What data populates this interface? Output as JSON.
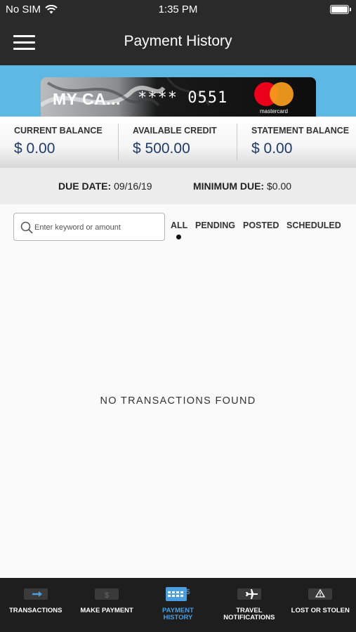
{
  "status": {
    "carrier": "No SIM",
    "time": "1:35 PM"
  },
  "nav": {
    "title": "Payment History"
  },
  "card": {
    "name": "MY CA...",
    "number": "**** 0551",
    "network": "mastercard"
  },
  "balances": [
    {
      "label": "CURRENT BALANCE",
      "value": "$ 0.00"
    },
    {
      "label": "AVAILABLE CREDIT",
      "value": "$ 500.00"
    },
    {
      "label": "STATEMENT BALANCE",
      "value": "$ 0.00"
    }
  ],
  "due": {
    "due_date_label": "DUE DATE:",
    "due_date_value": "09/16/19",
    "minimum_label": "MINIMUM DUE:",
    "minimum_value": "$0.00"
  },
  "search": {
    "placeholder": "Enter keyword or amount",
    "value": ""
  },
  "filters": {
    "selected": "ALL",
    "tabs": [
      "ALL",
      "PENDING",
      "POSTED",
      "SCHEDULED"
    ]
  },
  "empty_state": "NO TRANSACTIONS FOUND",
  "tab_bar": {
    "active": "payment-history",
    "items": [
      {
        "label": "TRANSACTIONS",
        "icon": "transactions-icon"
      },
      {
        "label": "MAKE PAYMENT",
        "icon": "make-payment-icon"
      },
      {
        "label": "PAYMENT HISTORY",
        "icon": "payment-history-icon"
      },
      {
        "label": "TRAVEL NOTIFICATIONS",
        "icon": "travel-notifications-icon"
      },
      {
        "label": "LOST OR STOLEN",
        "icon": "lost-or-stolen-icon"
      }
    ]
  },
  "colors": {
    "header_bg": "#2a2a2a",
    "banner_bg": "#5db8e4",
    "balance_value": "#1d3a69",
    "tab_active": "#4b9fe0",
    "tab_bar_bg": "#1e1e1e"
  }
}
